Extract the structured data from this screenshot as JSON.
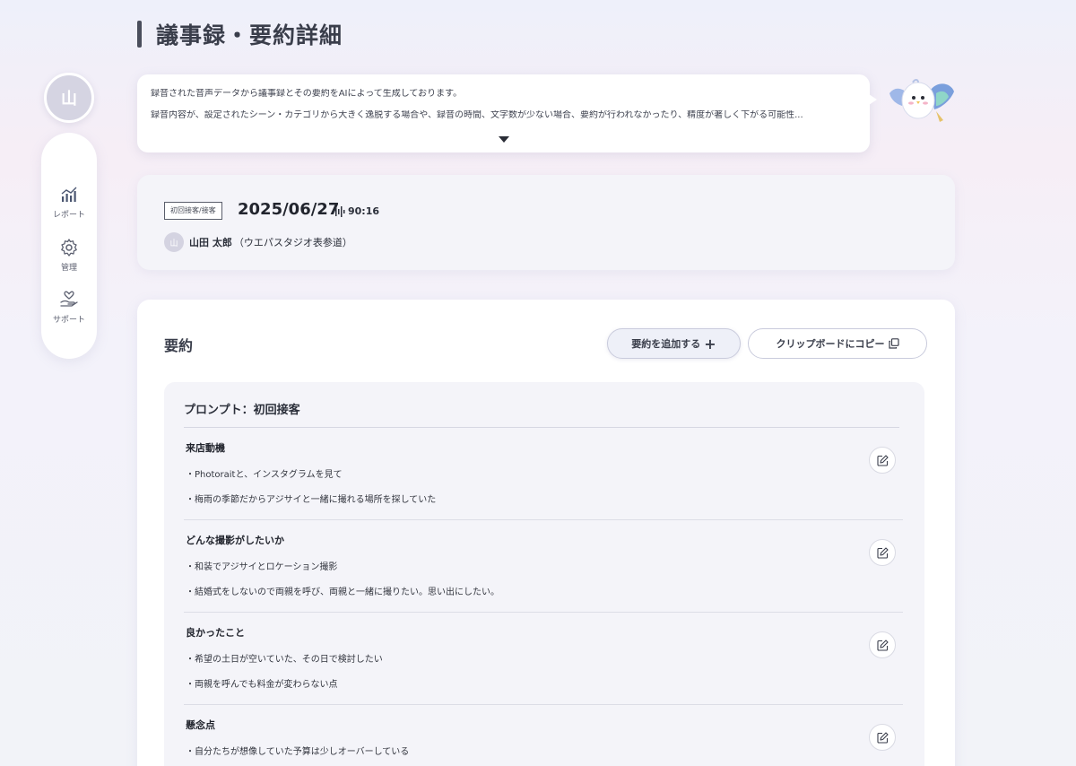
{
  "page": {
    "title": "議事録・要約詳細"
  },
  "user": {
    "avatar_initial": "山"
  },
  "sidebar": {
    "items": [
      {
        "label": "レポート",
        "icon": "chart-icon"
      },
      {
        "label": "管理",
        "icon": "gear-icon"
      },
      {
        "label": "サポート",
        "icon": "heart-hand-icon"
      }
    ]
  },
  "notice": {
    "line1": "録音された音声データから議事録とその要約をAIによって生成しております。",
    "line2": "録音内容が、設定されたシーン・カテゴリから大きく逸脱する場合や、録音の時間、文字数が少ない場合、要約が行われなかったり、精度が著しく下がる可能性..."
  },
  "meeting": {
    "scene_tag": "初回接客/接客",
    "date": "2025/06/27",
    "duration": "90:16",
    "person_initial": "山",
    "person_name": "山田 太郎",
    "store": "（ウエパスタジオ表参道）"
  },
  "summary": {
    "title": "要約",
    "add_label": "要約を追加する",
    "copy_label": "クリップボードにコピー",
    "prompt_title": "プロンプト：初回接客",
    "sections": [
      {
        "heading": "来店動機",
        "lines": [
          "・Photoraitと、インスタグラムを見て",
          "・梅雨の季節だからアジサイと一緒に撮れる場所を探していた"
        ]
      },
      {
        "heading": "どんな撮影がしたいか",
        "lines": [
          "・和装でアジサイとロケーション撮影",
          "・結婚式をしないので両親を呼び、両親と一緒に撮りたい。思い出にしたい。"
        ]
      },
      {
        "heading": "良かったこと",
        "lines": [
          "・希望の土日が空いていた、その日で検討したい",
          "・両親を呼んでも料金が変わらない点"
        ]
      },
      {
        "heading": "懸念点",
        "lines": [
          "・自分たちが想像していた予算は少しオーバーしている"
        ]
      }
    ]
  },
  "colors": {
    "accent": "#4a4e5c",
    "background": "#f2f3f8",
    "card": "#ffffff"
  }
}
